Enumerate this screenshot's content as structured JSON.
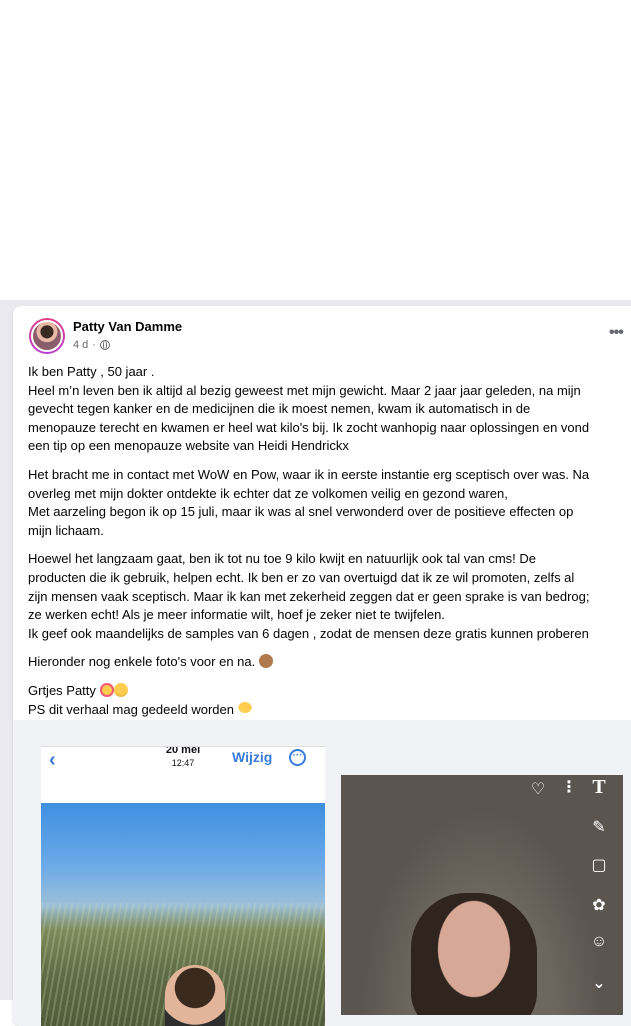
{
  "post": {
    "author": "Patty Van Damme",
    "time": "4 d",
    "more_label": "•••",
    "lines": [
      [
        "Ik ben Patty , 50 jaar .",
        "Heel m’n leven ben ik altijd al bezig geweest met mijn gewicht. Maar 2 jaar jaar geleden, na mijn",
        "gevecht tegen kanker en de medicijnen die ik moest nemen, kwam ik automatisch in de",
        "menopauze terecht en kwamen er heel wat kilo's bij. Ik zocht wanhopig naar oplossingen en vond",
        "een tip op een menopauze website van Heidi Hendrickx"
      ],
      [
        "Het bracht me in contact met WoW en Pow, waar ik in eerste instantie erg sceptisch over was. Na",
        "overleg met mijn dokter ontdekte ik echter dat ze volkomen veilig en gezond waren,",
        "Met aarzeling begon ik op 15 juli, maar ik was al snel verwonderd over de positieve effecten op",
        "mijn lichaam."
      ],
      [
        "Hoewel het langzaam gaat, ben ik tot nu toe 9 kilo kwijt en natuurlijk ook tal van cms! De",
        "producten die ik gebruik, helpen echt. Ik ben er zo van overtuigd dat ik ze wil promoten, zelfs al",
        "zijn mensen vaak sceptisch. Maar ik kan met zekerheid zeggen dat er geen sprake is van bedrog;",
        "ze werken echt! Als je meer informatie wilt, hoef je zeker niet te twijfelen.",
        "Ik geef ook maandelijks de samples van 6 dagen , zodat de mensen deze gratis kunnen proberen"
      ]
    ],
    "photos_line": "Hieronder nog enkele foto's voor en na.",
    "greeting": "Grtjes Patty",
    "ps": "PS  dit verhaal mag gedeeld worden"
  },
  "phone_screen": {
    "date": "20 mei",
    "time": "12:47",
    "edit_label": "Wijzig"
  },
  "icons": {
    "avatar": "profile-photo",
    "audience": "globe-icon",
    "snap_tools": [
      "heart-icon",
      "more-vertical-icon",
      "text-tool-icon",
      "pencil-icon",
      "sticker-icon",
      "camera-lens-icon",
      "add-sticker-icon",
      "chevron-down-icon"
    ]
  },
  "colors": {
    "feed_background": "#ebe9f0",
    "link_blue": "#3a7cdb",
    "meta_gray": "#65676b"
  }
}
